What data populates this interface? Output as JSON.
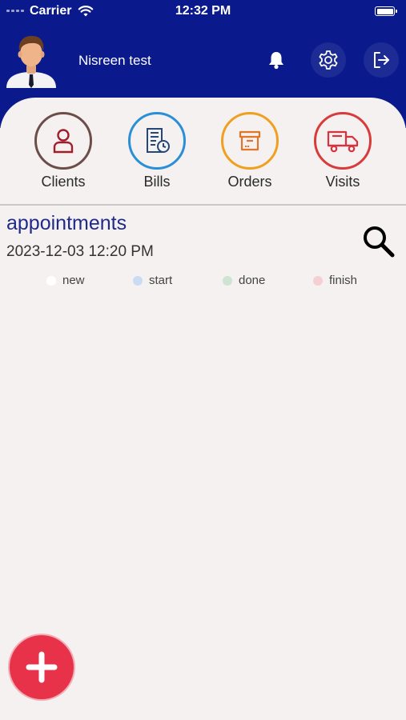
{
  "status_bar": {
    "carrier": "Carrier",
    "time": "12:32 PM"
  },
  "header": {
    "user_name": "Nisreen test",
    "background_color": "#0a1a8c",
    "icons": [
      "avatar",
      "bell-icon",
      "gear-icon",
      "logout-icon"
    ]
  },
  "quick_actions": [
    {
      "label": "Clients",
      "icon": "person-icon",
      "color": "#6b4e4a"
    },
    {
      "label": "Bills",
      "icon": "invoice-icon",
      "color": "#2a8fd6"
    },
    {
      "label": "Orders",
      "icon": "box-icon",
      "color": "#f0a020"
    },
    {
      "label": "Visits",
      "icon": "truck-icon",
      "color": "#d83b3b"
    }
  ],
  "appointments": {
    "title": "appointments",
    "datetime": "2023-12-03  12:20 PM",
    "legend": [
      {
        "label": "new",
        "color": "#ffffff"
      },
      {
        "label": "start",
        "color": "#c9dcf4"
      },
      {
        "label": "done",
        "color": "#cfe3d3"
      },
      {
        "label": "finish",
        "color": "#f6cfd2"
      }
    ]
  },
  "fab": {
    "icon": "plus-icon",
    "color": "#e8324a"
  }
}
